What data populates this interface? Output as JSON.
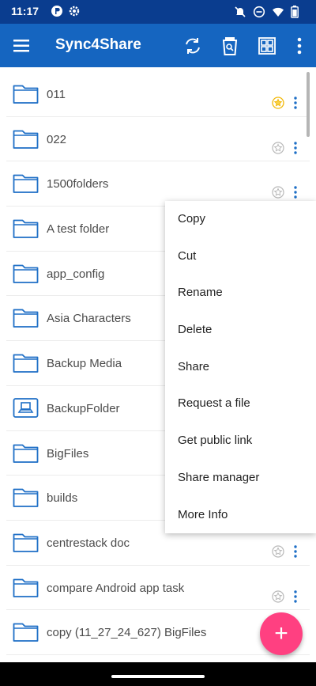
{
  "status_bar": {
    "time": "11:17",
    "left_icons": [
      "app-notification-icon",
      "settings-gear-icon"
    ],
    "right_icons": [
      "mute-icon",
      "do-not-disturb-icon",
      "wifi-icon",
      "battery-icon"
    ]
  },
  "app_bar": {
    "title": "Sync4Share",
    "icons": [
      "menu-icon",
      "sync-icon",
      "recycle-bin-icon",
      "grid-view-icon",
      "overflow-menu-icon"
    ]
  },
  "files": [
    {
      "name": "011",
      "type": "folder",
      "favorite": true
    },
    {
      "name": "022",
      "type": "folder",
      "favorite": false
    },
    {
      "name": "1500folders",
      "type": "folder",
      "favorite": false
    },
    {
      "name": "A test folder",
      "type": "folder",
      "favorite": false
    },
    {
      "name": "app_config",
      "type": "folder",
      "favorite": false
    },
    {
      "name": "Asia Characters",
      "type": "folder",
      "favorite": false
    },
    {
      "name": "Backup Media",
      "type": "folder",
      "favorite": false
    },
    {
      "name": "BackupFolder",
      "type": "backup-folder",
      "favorite": false
    },
    {
      "name": "BigFiles",
      "type": "folder",
      "favorite": false
    },
    {
      "name": "builds",
      "type": "folder",
      "favorite": false
    },
    {
      "name": "centrestack doc",
      "type": "folder",
      "favorite": false
    },
    {
      "name": "compare Android app task",
      "type": "folder",
      "favorite": false
    },
    {
      "name": "copy (11_27_24_627) BigFiles",
      "type": "folder",
      "favorite": false
    }
  ],
  "context_menu": {
    "items": [
      "Copy",
      "Cut",
      "Rename",
      "Delete",
      "Share",
      "Request a file",
      "Get public link",
      "Share manager",
      "More Info"
    ]
  },
  "fab": {
    "icon": "add-icon",
    "label": "+"
  },
  "colors": {
    "status_bar": "#0a3d8f",
    "app_bar": "#1565c0",
    "folder_icon": "#1e6fc6",
    "favorite_star": "#f2b807",
    "fab": "#ff4081"
  }
}
